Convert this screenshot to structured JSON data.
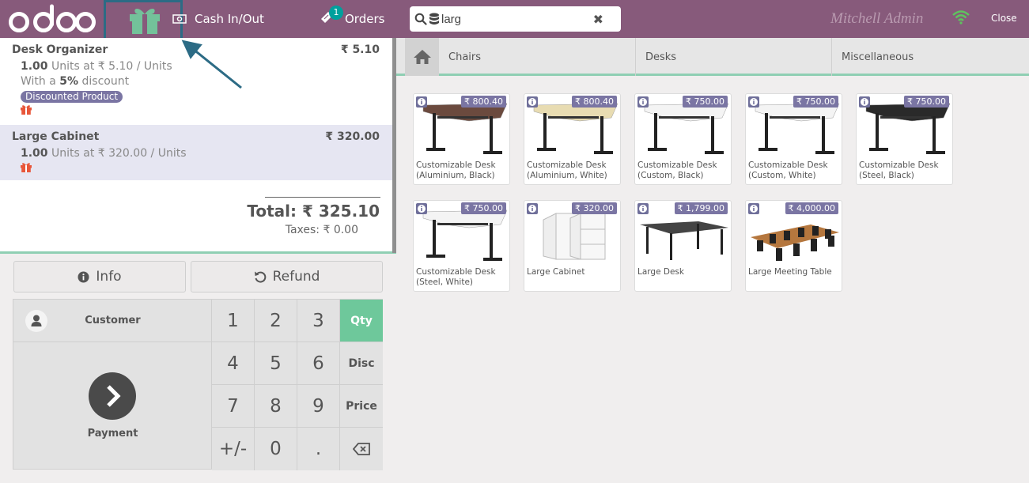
{
  "header": {
    "cash_label": "Cash In/Out",
    "orders_label": "Orders",
    "orders_badge": "1",
    "search_value": "larg",
    "user_name": "Mitchell Admin",
    "close_label": "Close"
  },
  "order": {
    "lines": [
      {
        "name": "Desk Organizer",
        "price": "₹ 5.10",
        "qty": "1.00",
        "unit_info": " Units at ₹ 5.10 / Units",
        "discount_prefix": "With a ",
        "discount": "5%",
        "discount_suffix": " discount",
        "tag": "Discounted Product"
      },
      {
        "name": "Large Cabinet",
        "price": "₹ 320.00",
        "qty": "1.00",
        "unit_info": " Units at ₹ 320.00 / Units"
      }
    ],
    "total": "Total: ₹ 325.10",
    "taxes": "Taxes: ₹ 0.00"
  },
  "controls": {
    "info_label": "Info",
    "refund_label": "Refund"
  },
  "numpad": {
    "customer_label": "Customer",
    "payment_label": "Payment",
    "keys": [
      "1",
      "2",
      "3",
      "4",
      "5",
      "6",
      "7",
      "8",
      "9",
      "+/-",
      "0",
      "."
    ],
    "modes": [
      "Qty",
      "Disc",
      "Price"
    ]
  },
  "categories": [
    "Chairs",
    "Desks",
    "Miscellaneous"
  ],
  "products": [
    {
      "name": "Customizable Desk (Aluminium, Black)",
      "price": "₹ 800.40"
    },
    {
      "name": "Customizable Desk (Aluminium, White)",
      "price": "₹ 800.40"
    },
    {
      "name": "Customizable Desk (Custom, Black)",
      "price": "₹ 750.00"
    },
    {
      "name": "Customizable Desk (Custom, White)",
      "price": "₹ 750.00"
    },
    {
      "name": "Customizable Desk (Steel, Black)",
      "price": "₹ 750.00"
    },
    {
      "name": "Customizable Desk (Steel, White)",
      "price": "₹ 750.00"
    },
    {
      "name": "Large Cabinet",
      "price": "₹ 320.00"
    },
    {
      "name": "Large Desk",
      "price": "₹ 1,799.00"
    },
    {
      "name": "Large Meeting Table",
      "price": "₹ 4,000.00"
    }
  ],
  "colors": {
    "brand": "#875a7b",
    "accent_green": "#6ec89b",
    "tag": "#7a75a3"
  }
}
